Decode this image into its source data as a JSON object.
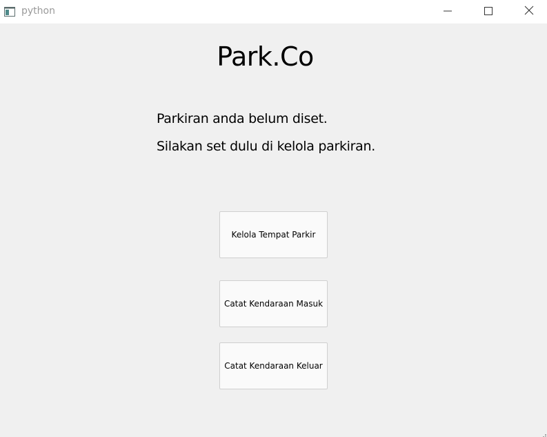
{
  "window": {
    "title": "python",
    "controls": {
      "minimize_icon": "minimize-icon",
      "maximize_icon": "maximize-icon",
      "close_icon": "close-icon"
    }
  },
  "main": {
    "app_title": "Park.Co",
    "message_line1": "Parkiran anda belum diset.",
    "message_line2": "Silakan set dulu di kelola parkiran.",
    "buttons": [
      {
        "label": "Kelola Tempat Parkir"
      },
      {
        "label": "Catat Kendaraan Masuk"
      },
      {
        "label": "Catat Kendaraan Keluar"
      }
    ]
  },
  "colors": {
    "background": "#f0f0f0",
    "titlebar": "#ffffff",
    "button_bg": "#fafafa",
    "button_border": "#cfcfcf"
  }
}
